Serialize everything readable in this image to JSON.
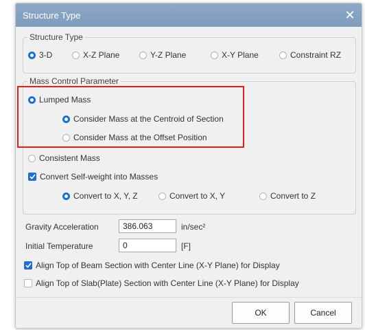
{
  "window": {
    "title": "Structure Type",
    "close_glyph": "✕"
  },
  "structure_type": {
    "legend": "Structure Type",
    "options": [
      "3-D",
      "X-Z Plane",
      "Y-Z Plane",
      "X-Y Plane",
      "Constraint RZ"
    ],
    "selected": "3-D"
  },
  "mass_control": {
    "legend": "Mass Control Parameter",
    "lumped_mass": "Lumped Mass",
    "centroid_option": "Consider Mass at the Centroid of Section",
    "offset_option": "Consider Mass at the Offset Position",
    "consistent_mass": "Consistent Mass",
    "convert_selfweight": "Convert Self-weight into Masses",
    "convert_options": [
      "Convert to X, Y, Z",
      "Convert to X, Y",
      "Convert to Z"
    ],
    "selected_mass_type": "Lumped Mass",
    "selected_position": "Consider Mass at the Centroid of Section",
    "selected_convert": "Convert to X, Y, Z",
    "convert_selfweight_checked": true
  },
  "gravity": {
    "label": "Gravity Acceleration",
    "value": "386.063",
    "unit": "in/sec²"
  },
  "temperature": {
    "label": "Initial Temperature",
    "value": "0",
    "unit": "[F]"
  },
  "options": {
    "align_beam": "Align Top of Beam Section with Center Line (X-Y Plane) for  Display",
    "align_beam_checked": true,
    "align_slab": "Align Top of Slab(Plate) Section with Center Line (X-Y Plane) for Display",
    "align_slab_checked": false
  },
  "buttons": {
    "ok": "OK",
    "cancel": "Cancel"
  },
  "colors": {
    "accent": "#1e6fd0",
    "highlight": "#e02020",
    "titlebar": "#7e9bbc"
  }
}
